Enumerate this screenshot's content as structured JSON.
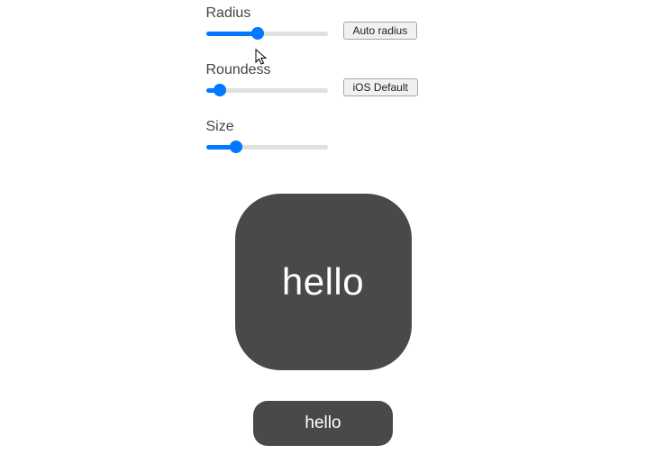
{
  "controls": {
    "radius": {
      "label": "Radius",
      "value": 42,
      "button": "Auto radius"
    },
    "roundess": {
      "label": "Roundess",
      "value": 7,
      "button": "iOS Default"
    },
    "size": {
      "label": "Size",
      "value": 22
    }
  },
  "preview": {
    "big_text": "hello",
    "small_text": "hello",
    "shape_bg": "#47494b",
    "shape_fg": "#ffffff"
  }
}
